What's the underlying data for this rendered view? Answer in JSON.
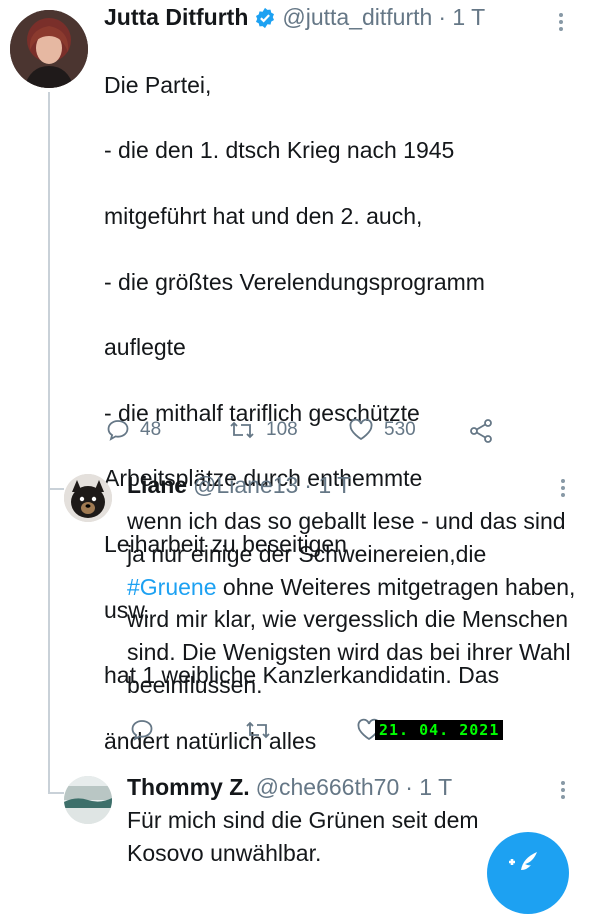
{
  "tweet": {
    "author": "Jutta Ditfurth",
    "handle": "@jutta_ditfurth",
    "time": "· 1 T",
    "text_lines": [
      "Die Partei,",
      "- die den 1. dtsch Krieg nach 1945",
      "mitgeführt hat und den 2. auch,",
      "- die größtes Verelendungsprogramm",
      "auflegte",
      "- die mithalf tariflich geschützte",
      "Arbeitsplätze durch enthemmte",
      "Leiharbeit zu beseitigen",
      "usw.",
      "hat 1 weibliche Kanzlerkandidatin. Das",
      "ändert natürlich alles"
    ],
    "replies": "48",
    "retweets": "108",
    "likes": "530"
  },
  "reply1": {
    "author": "Liane",
    "handle": "@Liane13",
    "time": "· 1 T",
    "text_before": "wenn ich das so geballt lese - und das sind ja nur einige der Schweinereien,die ",
    "hashtag": "#Gruene",
    "text_after": " ohne Weiteres mitgetragen haben, wird mir klar, wie vergesslich die Menschen sind. Die Wenigsten wird das bei ihrer Wahl beeinflussen."
  },
  "date_stamp": "21. 04. 2021",
  "reply2": {
    "author": "Thommy Z.",
    "handle": "@che666th70",
    "time": "· 1 T",
    "text": "Für mich sind die Grünen seit dem Kosovo unwählbar."
  },
  "colors": {
    "accent": "#1da1f2",
    "verified": "#1da1f2",
    "text": "#14171a",
    "secondary": "#657786",
    "date_stamp_fg": "#00ff00",
    "date_stamp_bg": "#000000"
  },
  "icons": {
    "verified": "verified-badge-icon",
    "reply": "reply-icon",
    "retweet": "retweet-icon",
    "like": "heart-icon",
    "share": "share-icon",
    "more": "more-vertical-icon",
    "compose": "compose-tweet-icon"
  }
}
